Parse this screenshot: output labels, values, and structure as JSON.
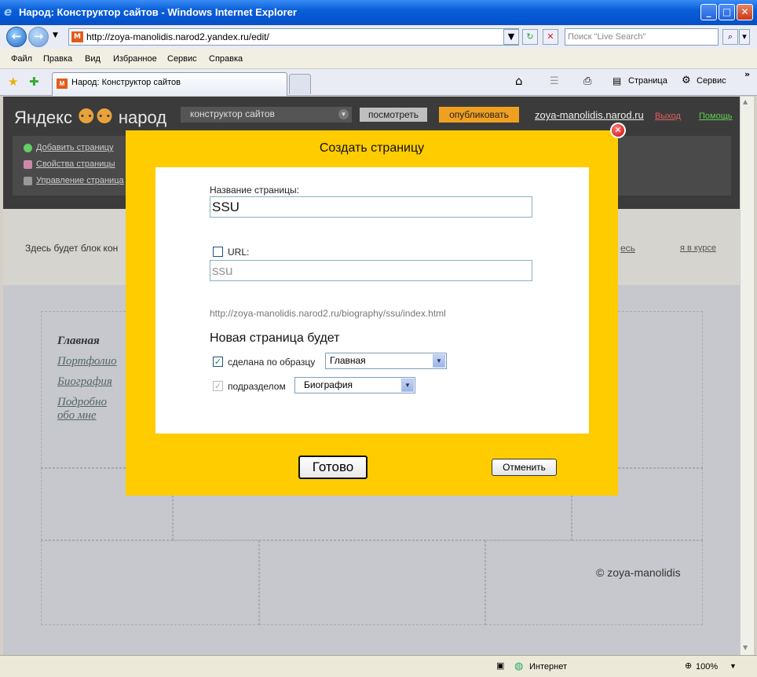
{
  "window": {
    "title": "Народ: Конструктор сайтов - Windows Internet Explorer",
    "min": "_",
    "max": "□",
    "close": "✕"
  },
  "address": {
    "url": "http://zoya-manolidis.narod2.yandex.ru/edit/",
    "search_placeholder": "Поиск \"Live Search\""
  },
  "menu": [
    "Файл",
    "Правка",
    "Вид",
    "Избранное",
    "Сервис",
    "Справка"
  ],
  "tab": {
    "title": "Народ: Конструктор сайтов"
  },
  "toolbar": {
    "page": "Страница",
    "service": "Сервис"
  },
  "site": {
    "logo_left": "Яндекс",
    "logo_right": "народ",
    "mode_select": "конструктор сайтов",
    "view_button": "посмотреть",
    "publish_button": "опубликовать",
    "site_link": "zoya-manolidis.narod.ru",
    "exit_link": "Выход",
    "help_link": "Помощь",
    "panel_links": [
      "Добавить страницу",
      "Свойства страницы",
      "Управление страница"
    ],
    "notice_text": "Здесь будет блок кон",
    "notice_link": "есь",
    "notice_ok": "я в курсе",
    "nav_items": [
      "Главная",
      "Портфолио",
      "Биография",
      "Подробно",
      "обо мне"
    ],
    "copyright": "© zoya-manolidis"
  },
  "dialog": {
    "title": "Создать страницу",
    "name_label": "Название страницы:",
    "name_value": "SSU",
    "url_label": "URL:",
    "url_value": "ssu",
    "url_preview": "http://zoya-manolidis.narod2.ru/biography/ssu/index.html",
    "section_heading": "Новая страница будет",
    "template_label": "сделана по образцу",
    "template_value": "Главная",
    "parent_label": "подразделом",
    "parent_value": "Биография",
    "done_button": "Готово",
    "cancel_button": "Отменить"
  },
  "status": {
    "zone": "Интернет",
    "zoom": "100%"
  }
}
